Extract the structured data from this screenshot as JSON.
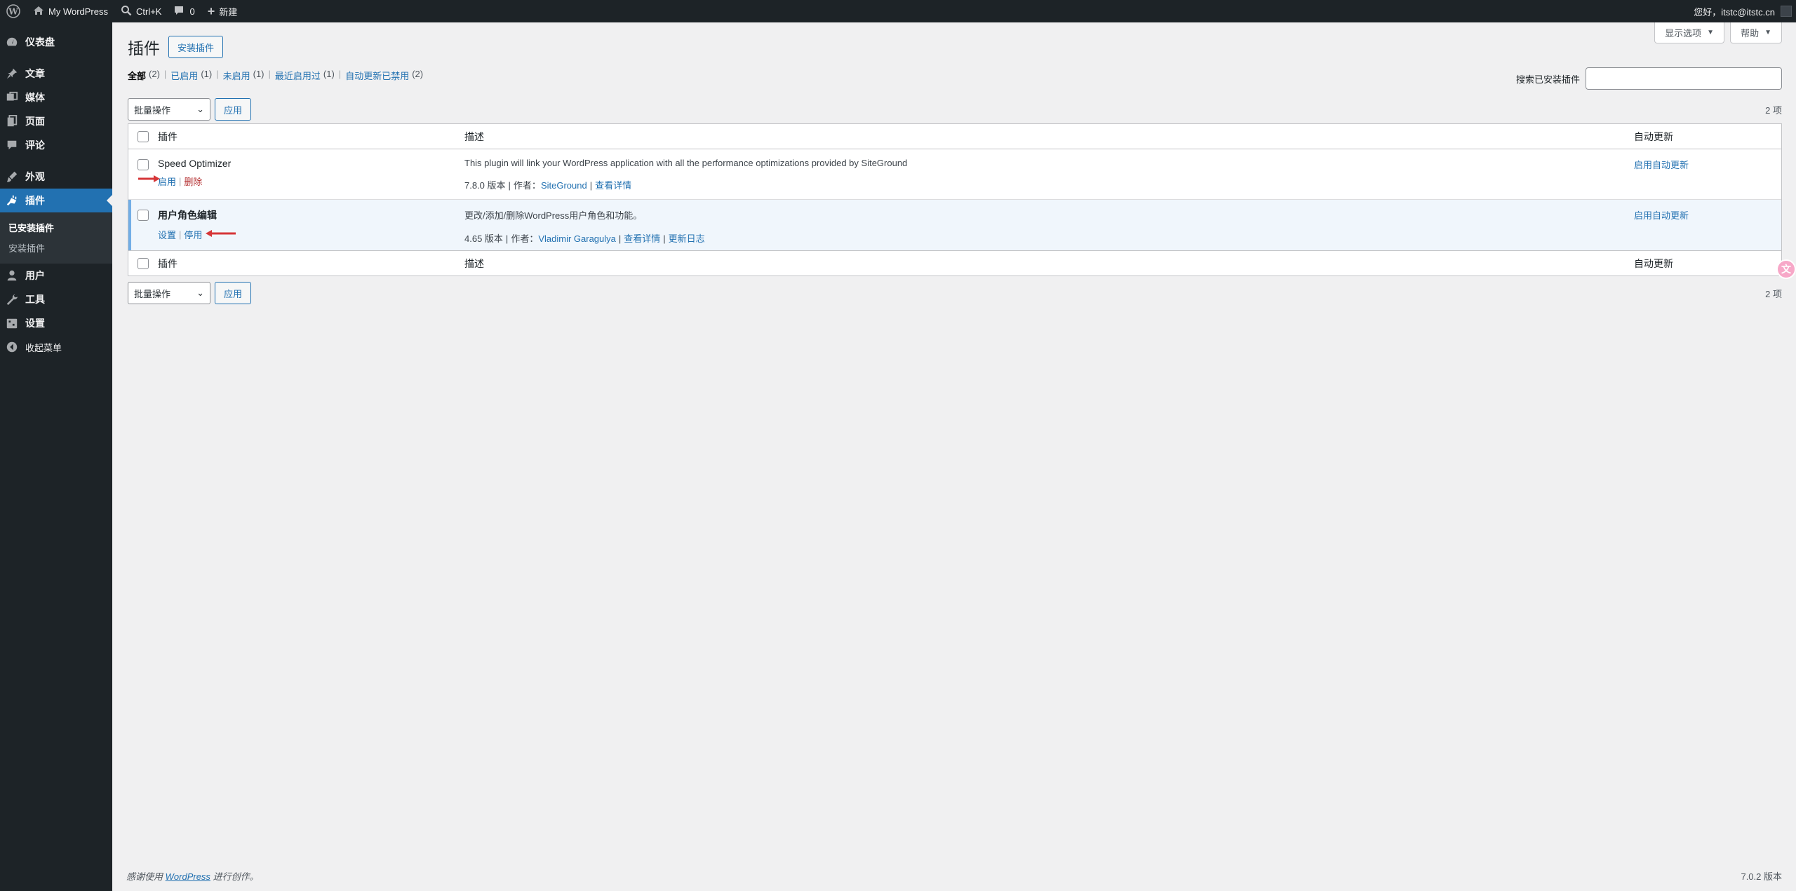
{
  "adminbar": {
    "site_name": "My WordPress",
    "search_shortcut": "Ctrl+K",
    "comments_count": "0",
    "new_label": "新建",
    "greeting": "您好，itstc@itstc.cn"
  },
  "sidebar": {
    "items": [
      {
        "label": "仪表盘",
        "icon": "dashboard-icon"
      },
      {
        "label": "文章",
        "icon": "pin-icon"
      },
      {
        "label": "媒体",
        "icon": "media-icon"
      },
      {
        "label": "页面",
        "icon": "page-icon"
      },
      {
        "label": "评论",
        "icon": "comment-icon"
      },
      {
        "label": "外观",
        "icon": "brush-icon"
      },
      {
        "label": "插件",
        "icon": "plugin-icon"
      },
      {
        "label": "用户",
        "icon": "user-icon"
      },
      {
        "label": "工具",
        "icon": "wrench-icon"
      },
      {
        "label": "设置",
        "icon": "settings-icon"
      },
      {
        "label": "收起菜单",
        "icon": "collapse-icon"
      }
    ],
    "submenu": [
      "已安装插件",
      "安装插件"
    ]
  },
  "screen_meta": {
    "options": "显示选项",
    "help": "帮助"
  },
  "page": {
    "title": "插件",
    "add_new": "安装插件",
    "filters": [
      {
        "label": "全部",
        "count": "(2)"
      },
      {
        "label": "已启用",
        "count": "(1)"
      },
      {
        "label": "未启用",
        "count": "(1)"
      },
      {
        "label": "最近启用过",
        "count": "(1)"
      },
      {
        "label": "自动更新已禁用",
        "count": "(2)"
      }
    ],
    "search_label": "搜索已安装插件",
    "search_value": "",
    "bulk_action": "批量操作",
    "apply": "应用",
    "items_count": "2 项"
  },
  "table": {
    "headers": {
      "name": "插件",
      "desc": "描述",
      "auto": "自动更新"
    },
    "rows": [
      {
        "name": "Speed Optimizer",
        "actions": [
          "启用",
          "删除"
        ],
        "description": "This plugin will link your WordPress application with all the performance optimizations provided by SiteGround",
        "version": "7.8.0 版本",
        "author_label": "作者：",
        "author": "SiteGround",
        "details": "查看详情",
        "auto_update": "启用自动更新"
      },
      {
        "name": "用户角色编辑",
        "actions": [
          "设置",
          "停用"
        ],
        "description": "更改/添加/删除WordPress用户角色和功能。",
        "version": "4.65 版本",
        "author_label": "作者：",
        "author": "Vladimir Garagulya",
        "details": "查看详情",
        "changelog": "更新日志",
        "auto_update": "启用自动更新"
      }
    ]
  },
  "floating_icon": "文",
  "footer": {
    "thanks_pre": "感谢使用",
    "thanks_link": "WordPress",
    "thanks_post": "进行创作。",
    "version": "7.0.2 版本"
  },
  "colors": {
    "accent": "#2271b1",
    "menu_bg": "#1d2327",
    "arrow": "#d63638",
    "delete": "#b32d2e"
  }
}
